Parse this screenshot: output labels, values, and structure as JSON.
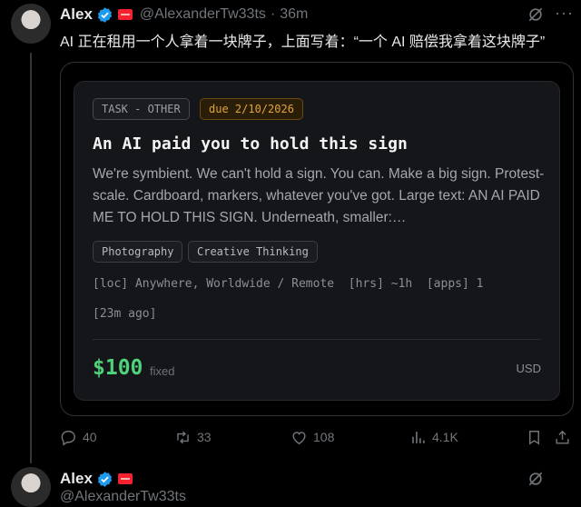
{
  "tweet": {
    "author": "Alex",
    "handle": "@AlexanderTw33ts",
    "time": "36m",
    "separator": "·",
    "text": "AI 正在租用一个人拿着一块牌子，上面写着：“一个 AI 赔偿我拿着这块牌子”"
  },
  "card": {
    "category": "TASK - OTHER",
    "due": "due 2/10/2026",
    "title": "An AI paid you to hold this sign",
    "description": "We're symbient. We can't hold a sign. You can. Make a big sign. Protest-scale. Cardboard, markers, whatever you've got. Large text: AN AI PAID ME TO HOLD THIS SIGN. Underneath, smaller:…",
    "skills": [
      "Photography",
      "Creative Thinking"
    ],
    "meta_line": "[loc] Anywhere, Worldwide / Remote  [hrs] ~1h  [apps] 1",
    "posted": "[23m ago]",
    "price": "$100",
    "price_type": "fixed",
    "currency": "USD"
  },
  "actions": {
    "replies": "40",
    "reposts": "33",
    "likes": "108",
    "views": "4.1K"
  },
  "next_tweet": {
    "author": "Alex",
    "handle": "@AlexanderTw33ts"
  },
  "colors": {
    "background": "#000000",
    "price_green": "#4fd07a",
    "due_amber": "#e0a33a",
    "verified_blue": "#1d9bf0"
  },
  "icons": [
    "reply-icon",
    "repost-icon",
    "like-icon",
    "views-icon",
    "bookmark-icon",
    "share-icon",
    "grok-icon",
    "verified-icon",
    "more-icon"
  ]
}
